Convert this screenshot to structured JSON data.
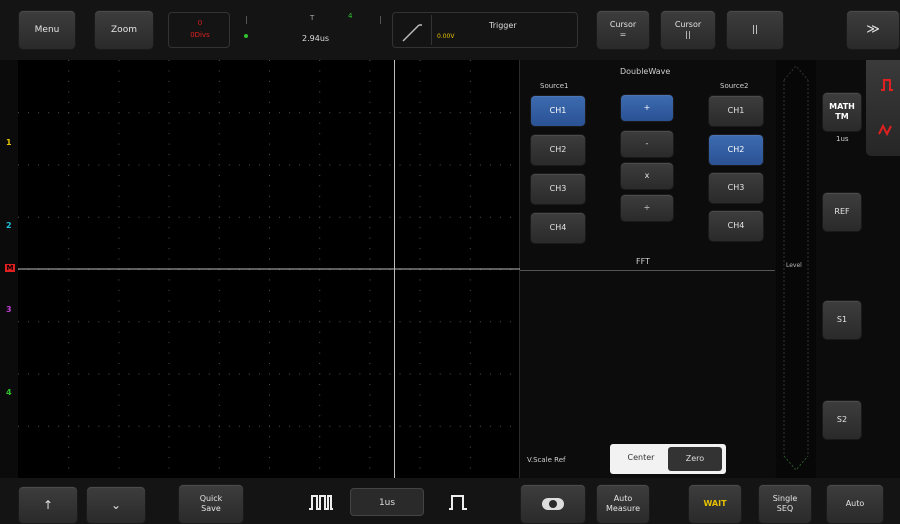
{
  "top": {
    "menu_label": "Menu",
    "zoom_label": "Zoom",
    "delay_top": "0",
    "delay_bottom": "0Divs",
    "t_marker": "T",
    "time_value": "2.94us",
    "trigger_title": "Trigger",
    "trigger_value": "0.00V",
    "cursor1_label": "Cursor\n=",
    "cursor2_label": "Cursor\n||",
    "pause_label": "||",
    "collapse_label": "≫"
  },
  "channels": {
    "ch1_marker": "1",
    "ch2_marker": "2",
    "ch3_marker": "3",
    "ch4_marker": "4",
    "math_marker": "M",
    "colors": {
      "ch1": "#e6c200",
      "ch2": "#22c0e0",
      "ch3": "#c040d0",
      "ch4": "#30c030",
      "math": "#e02020"
    }
  },
  "math_panel": {
    "title": "DoubleWave",
    "source1_label": "Source1",
    "source2_label": "Source2",
    "source1": [
      "CH1",
      "CH2",
      "CH3",
      "CH4"
    ],
    "operators": [
      "+",
      "-",
      "x",
      "÷"
    ],
    "source2": [
      "CH1",
      "CH2",
      "CH3",
      "CH4"
    ],
    "fft_label": "FFT",
    "vscale_label": "V.Scale Ref",
    "center_label": "Center",
    "zero_label": "Zero",
    "level_label": "Level"
  },
  "side": {
    "math_button": "MATH\nTM",
    "math_sub": "1us",
    "ref_button": "REF",
    "s1_button": "S1",
    "s2_button": "S2"
  },
  "bottom": {
    "up_label": "↑",
    "down_label": "⌄",
    "quick_save": "Quick\nSave",
    "timebase": "1us",
    "auto_measure": "Auto\nMeasure",
    "wait": "WAIT",
    "single": "Single\nSEQ",
    "auto": "Auto"
  }
}
